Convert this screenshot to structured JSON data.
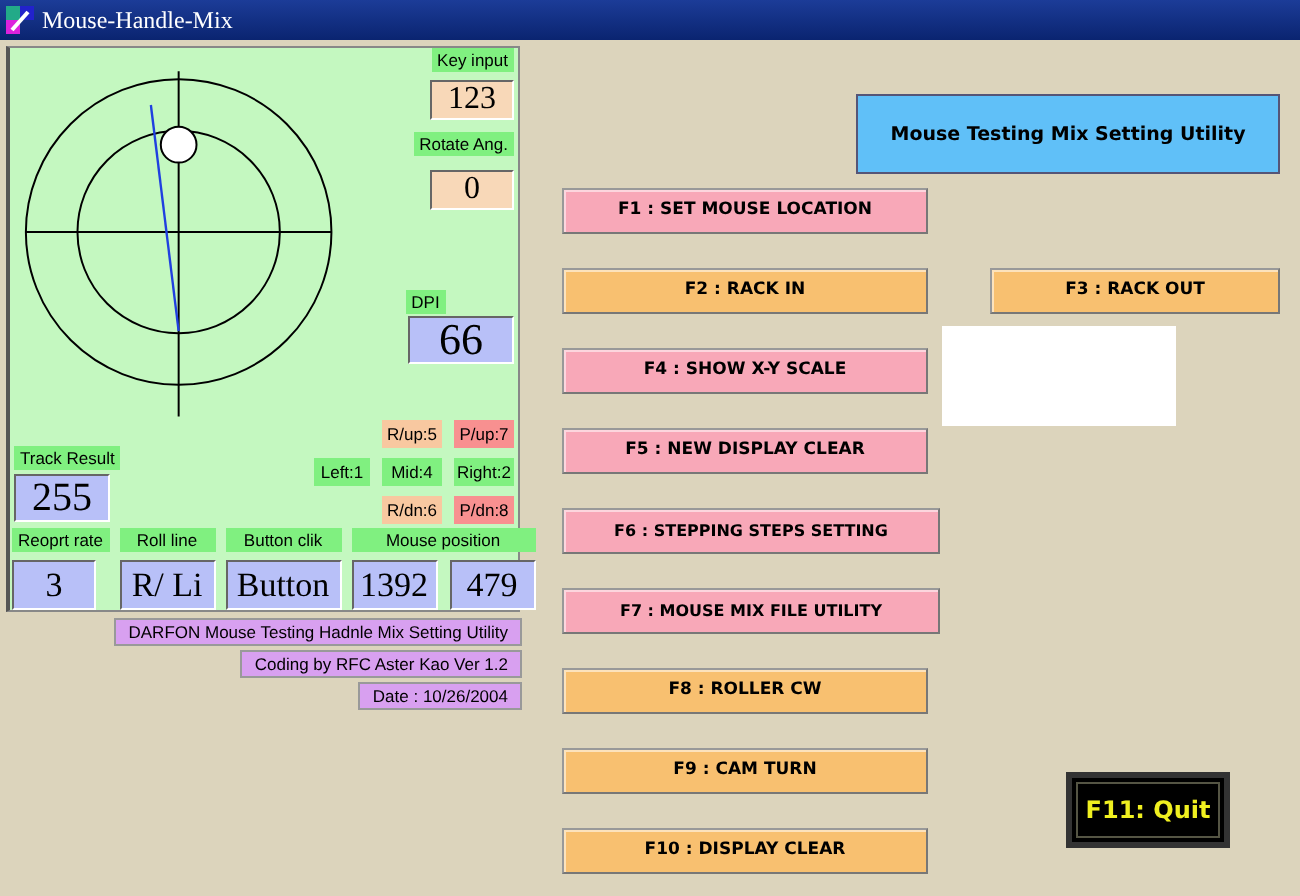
{
  "window": {
    "title": "Mouse-Handle-Mix"
  },
  "panel": {
    "key_input": {
      "label": "Key input",
      "value": "123"
    },
    "rotate_angle": {
      "label": "Rotate Ang.",
      "value": "0"
    },
    "dpi": {
      "label": "DPI",
      "value": "66"
    },
    "track_result": {
      "label": "Track  Result",
      "value": "255"
    },
    "indicators": [
      {
        "label": "R/up:5",
        "color": "#f8c8a0"
      },
      {
        "label": "P/up:7",
        "color": "#f89090"
      },
      {
        "label": "Left:1",
        "color": "#80f080"
      },
      {
        "label": "Mid:4",
        "color": "#80f080"
      },
      {
        "label": "Right:2",
        "color": "#80f080"
      },
      {
        "label": "R/dn:6",
        "color": "#f8c8a0"
      },
      {
        "label": "P/dn:8",
        "color": "#f89090"
      }
    ],
    "fields": [
      {
        "label": "Reoprt rate",
        "values": [
          "3"
        ]
      },
      {
        "label": "Roll line",
        "values": [
          "R/ Li"
        ]
      },
      {
        "label": "Button clik",
        "values": [
          "Button"
        ]
      },
      {
        "label": "Mouse position",
        "values": [
          "1392",
          "479"
        ]
      }
    ]
  },
  "credits": [
    "DARFON Mouse Testing Hadnle  Mix Setting Utility",
    "Coding by RFC Aster Kao Ver 1.2",
    "Date : 10/26/2004"
  ],
  "header": "Mouse Testing Mix Setting Utility",
  "buttons": [
    {
      "label": "F1 : SET MOUSE LOCATION",
      "color": "#f8a8b8"
    },
    {
      "label": "F2 : RACK IN",
      "color": "#f8c070"
    },
    {
      "label": "F4 : SHOW X-Y SCALE",
      "color": "#f8a8b8"
    },
    {
      "label": "F5 : NEW DISPLAY CLEAR",
      "color": "#f8a8b8"
    },
    {
      "label": "F6 : STEPPING STEPS SETTING",
      "color": "#f8a8b8"
    },
    {
      "label": "F7 : MOUSE MIX FILE UTILITY",
      "color": "#f8a8b8"
    },
    {
      "label": "F8 : ROLLER CW",
      "color": "#f8c070"
    },
    {
      "label": "F9 : CAM TURN",
      "color": "#f8c070"
    },
    {
      "label": "F10 : DISPLAY CLEAR",
      "color": "#f8c070"
    }
  ],
  "side_button": {
    "label": "F3 : RACK OUT",
    "color": "#f8c070"
  },
  "quit_button": {
    "label": "F11: Quit"
  }
}
